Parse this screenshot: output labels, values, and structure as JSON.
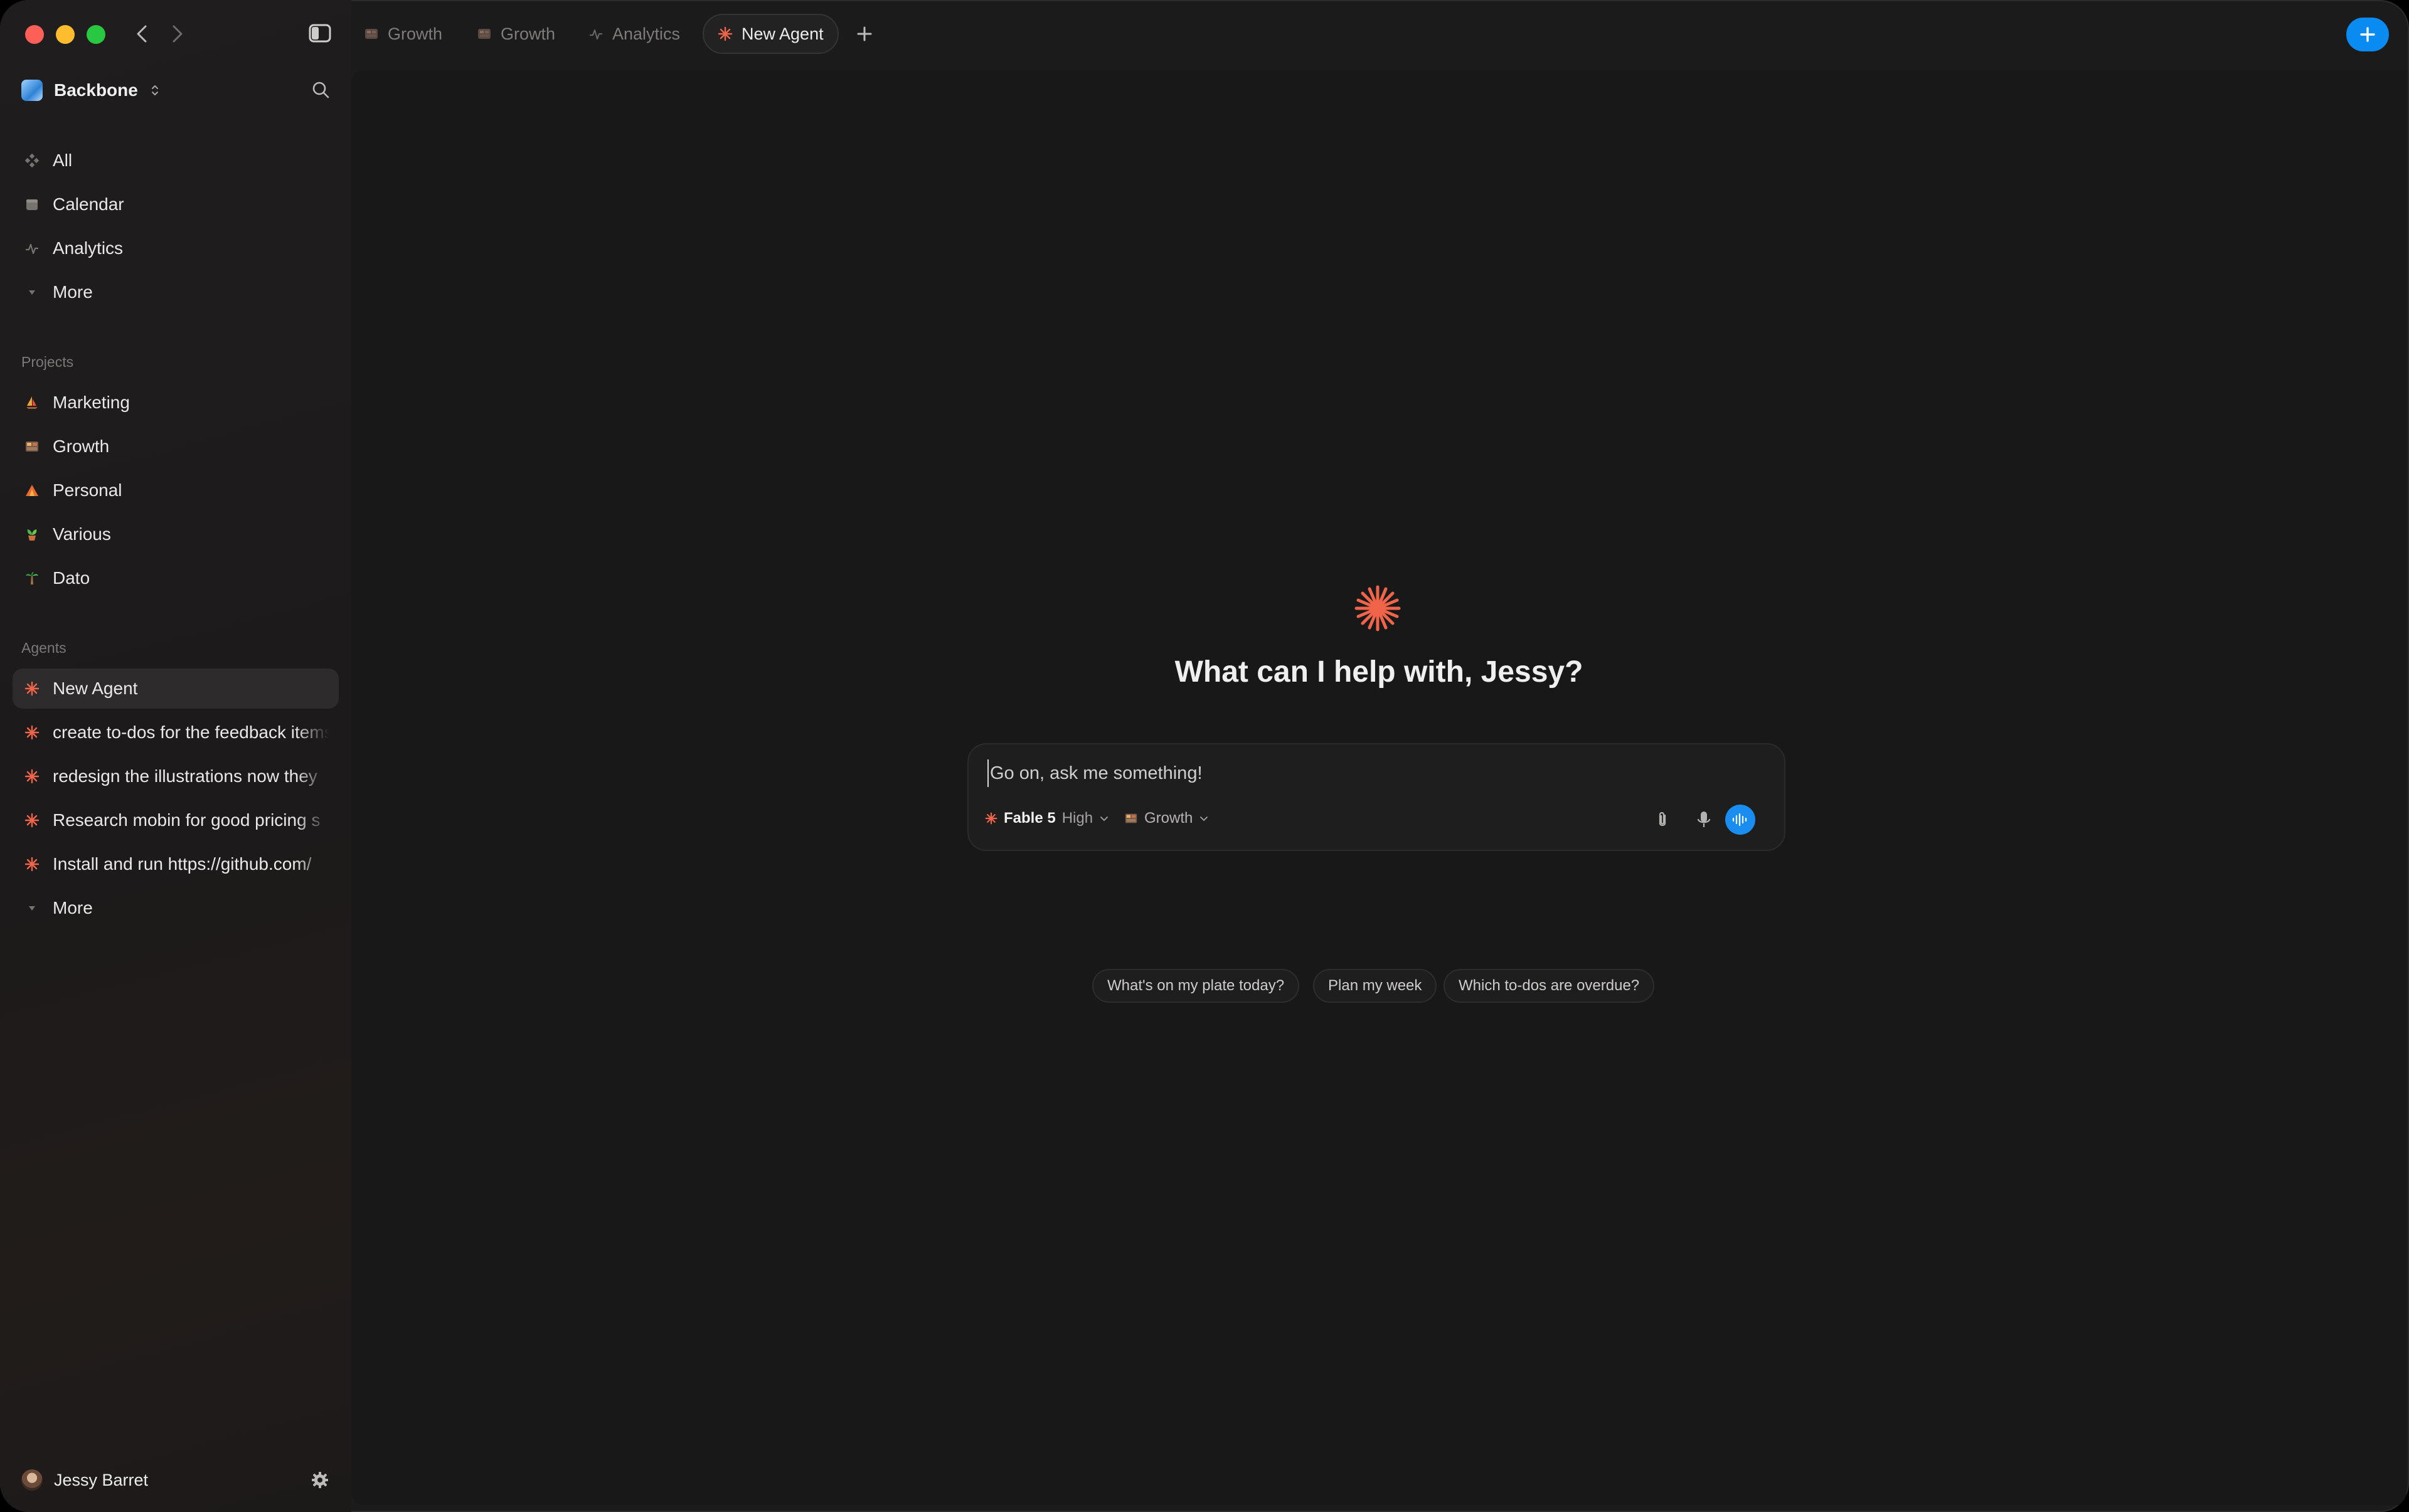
{
  "window": {
    "tabs": [
      {
        "label": "Growth",
        "icon": "project-grid-icon",
        "active": false
      },
      {
        "label": "Growth",
        "icon": "project-grid-icon",
        "active": false
      },
      {
        "label": "Analytics",
        "icon": "pulse-icon",
        "active": false
      },
      {
        "label": "New Agent",
        "icon": "spark-icon",
        "active": true
      }
    ]
  },
  "sidebar": {
    "workspace_name": "Backbone",
    "nav": [
      {
        "label": "All",
        "icon": "diamond-grid-icon"
      },
      {
        "label": "Calendar",
        "icon": "calendar-icon"
      },
      {
        "label": "Analytics",
        "icon": "pulse-icon"
      },
      {
        "label": "More",
        "icon": "caret-down-icon"
      }
    ],
    "projects_title": "Projects",
    "projects": [
      {
        "label": "Marketing",
        "icon": "sailboat-icon"
      },
      {
        "label": "Growth",
        "icon": "photo-grid-icon"
      },
      {
        "label": "Personal",
        "icon": "tent-icon"
      },
      {
        "label": "Various",
        "icon": "plant-icon"
      },
      {
        "label": "Dato",
        "icon": "palm-icon"
      }
    ],
    "agents_title": "Agents",
    "agents": [
      {
        "label": "New Agent",
        "selected": true
      },
      {
        "label": "create to-dos for the feedback items"
      },
      {
        "label": "redesign the illustrations now they"
      },
      {
        "label": "Research mobin for good pricing s"
      },
      {
        "label": "Install and run https://github.com/"
      }
    ],
    "agents_more": "More",
    "user_name": "Jessy Barret"
  },
  "main": {
    "greeting": "What can I help with, Jessy?",
    "composer": {
      "placeholder": "Go on, ask me something!",
      "model_name": "Fable 5",
      "model_level": "High",
      "project": "Growth"
    },
    "suggestions": [
      "What's on my plate today?",
      "Plan my week",
      "Which to-dos are overdue?"
    ]
  },
  "colors": {
    "accent_blue": "#0a8bf2",
    "agent_orange": "#f0654a",
    "background": "#181818",
    "sidebar": "#1c1b1b"
  }
}
